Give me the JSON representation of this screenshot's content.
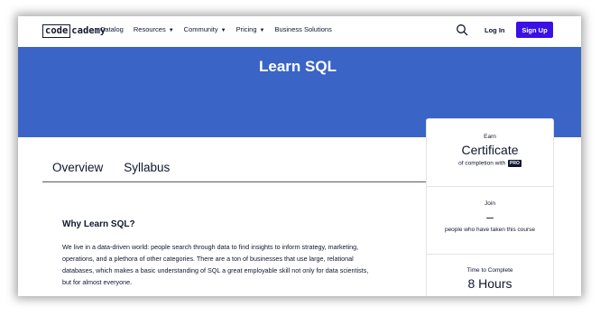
{
  "nav": {
    "logo_box": "code",
    "logo_rest": "cademy",
    "links": [
      {
        "label": "Catalog",
        "dropdown": false
      },
      {
        "label": "Resources",
        "dropdown": true
      },
      {
        "label": "Community",
        "dropdown": true
      },
      {
        "label": "Pricing",
        "dropdown": true
      },
      {
        "label": "Business Solutions",
        "dropdown": false
      }
    ],
    "login": "Log In",
    "signup": "Sign Up"
  },
  "hero": {
    "title": "Learn SQL"
  },
  "tabs": [
    "Overview",
    "Syllabus"
  ],
  "content": {
    "heading": "Why Learn SQL?",
    "paragraph": "We live in a data-driven world: people search through data to find insights to inform strategy, marketing, operations, and a plethora of other categories. There are a ton of businesses that use large, relational databases, which makes a basic understanding of SQL a great employable skill not only for data scientists, but for almost everyone."
  },
  "card": {
    "earn_label": "Earn",
    "earn_value": "Certificate",
    "earn_sub": "of completion with",
    "pro_badge": "PRO",
    "join_label": "Join",
    "join_value": "–",
    "join_sub": "people who have taken this course",
    "time_label": "Time to Complete",
    "time_value": "8 Hours"
  },
  "colors": {
    "hero": "#3a64c6",
    "signup": "#3a10e5",
    "text": "#10162f"
  }
}
